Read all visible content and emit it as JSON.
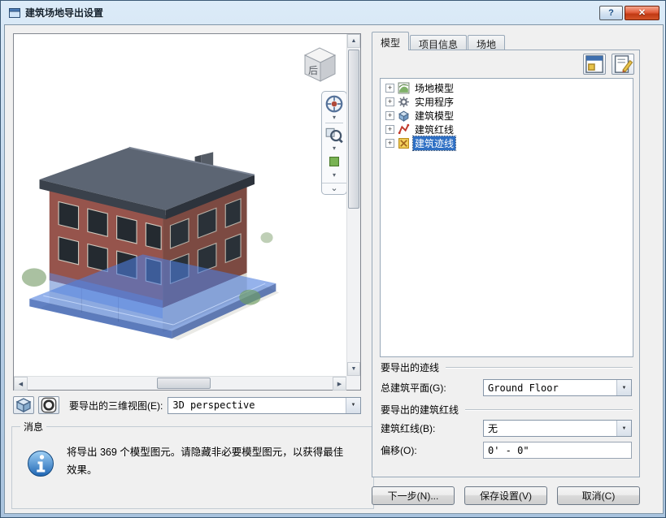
{
  "window": {
    "title": "建筑场地导出设置"
  },
  "icons": {
    "help": "?",
    "close": "✕",
    "expander_plus": "+",
    "combo_arrow": "▼",
    "scroll_up": "▲",
    "scroll_down": "▼",
    "scroll_left": "◀",
    "scroll_right": "▶",
    "nav_more": "▾",
    "nav_chevron": "⌄"
  },
  "preview": {
    "viewcube_label": "后"
  },
  "view_selector": {
    "label": "要导出的三维视图(E):",
    "value": "3D perspective"
  },
  "message": {
    "legend": "消息",
    "text": "将导出 369 个模型图元。请隐藏非必要模型图元，以获得最佳效果。"
  },
  "tabs": [
    {
      "label": "模型"
    },
    {
      "label": "项目信息"
    },
    {
      "label": "场地"
    }
  ],
  "tree": {
    "items": [
      {
        "label": "场地模型",
        "icon": "site-model-icon",
        "selected": false
      },
      {
        "label": "实用程序",
        "icon": "utilities-icon",
        "selected": false
      },
      {
        "label": "建筑模型",
        "icon": "building-model-icon",
        "selected": false
      },
      {
        "label": "建筑红线",
        "icon": "property-line-icon",
        "selected": false
      },
      {
        "label": "建筑迹线",
        "icon": "footprint-icon",
        "selected": true
      }
    ]
  },
  "footprint_section": {
    "title": "要导出的迹线",
    "plan_label": "总建筑平面(G):",
    "plan_value": "Ground Floor"
  },
  "property_line_section": {
    "title": "要导出的建筑红线",
    "line_label": "建筑红线(B):",
    "line_value": "无",
    "offset_label": "偏移(O):",
    "offset_value": "0' - 0\""
  },
  "footer": {
    "next": "下一步(N)...",
    "save": "保存设置(V)",
    "cancel": "取消(C)"
  },
  "colors": {
    "selection_highlight": "#2e6fc4",
    "title_bar": "#bcd2e8",
    "close_button": "#c03913"
  }
}
